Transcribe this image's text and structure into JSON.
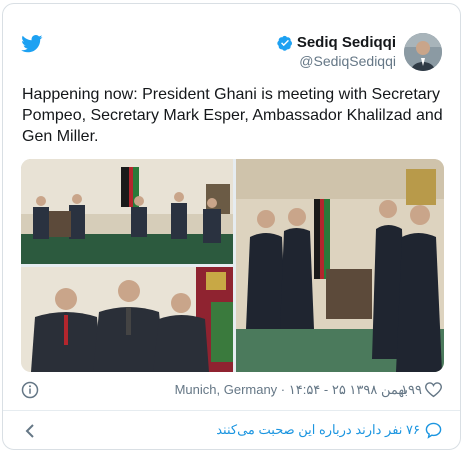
{
  "header": {
    "display_name": "Sediq Sediqqi",
    "handle": "@SediqSediqqi",
    "icons": {
      "logo": "twitter-bird-icon",
      "badge": "verified-badge-icon"
    }
  },
  "tweet": {
    "text": "Happening now: President Ghani is meeting with Secretary Pompeo, Secretary Mark Esper, Ambassador Khalilzad and Gen Miller."
  },
  "meta": {
    "location_time": "Munich, Germany · ۱۴:۵۴ - ۲۵ بهمن ۱۳۹۸",
    "likes": "۱۹۹"
  },
  "footer": {
    "discussion": "۷۶ نفر دارند درباره این صحبت می‌کنند"
  },
  "colors": {
    "brand_blue": "#1da1f2",
    "link_blue": "#1b95e0",
    "muted": "#657786"
  }
}
